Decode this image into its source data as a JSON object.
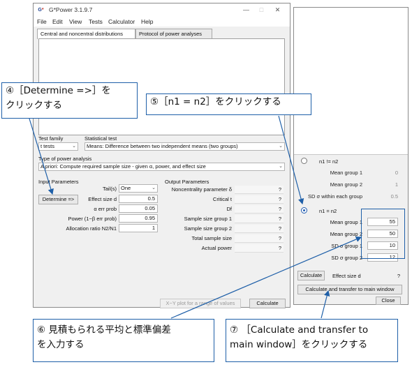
{
  "window": {
    "title": "G*Power 3.1.9.7",
    "minimize_glyph": "—",
    "maximize_glyph": "□",
    "close_glyph": "✕"
  },
  "menu": [
    "File",
    "Edit",
    "View",
    "Tests",
    "Calculator",
    "Help"
  ],
  "tabs": [
    "Central and noncentral distributions",
    "Protocol of power analyses"
  ],
  "test_family": {
    "label": "Test family",
    "value": "t tests"
  },
  "statistical_test": {
    "label": "Statistical test",
    "value": "Means: Difference between two independent means (two groups)"
  },
  "analysis_type": {
    "label": "Type of power analysis",
    "value": "A priori: Compute required sample size - given α, power, and effect size"
  },
  "input": {
    "header": "Input Parameters",
    "tails_label": "Tail(s)",
    "tails_value": "One",
    "determine_label": "Determine =>",
    "effect_label": "Effect size d",
    "effect_value": "0.5",
    "alpha_label": "α err prob",
    "alpha_value": "0.05",
    "power_label": "Power (1−β err prob)",
    "power_value": "0.95",
    "ratio_label": "Allocation ratio N2/N1",
    "ratio_value": "1"
  },
  "output": {
    "header": "Output Parameters",
    "rows": [
      {
        "label": "Noncentrality parameter δ",
        "value": "?"
      },
      {
        "label": "Critical t",
        "value": "?"
      },
      {
        "label": "Df",
        "value": "?"
      },
      {
        "label": "Sample size group 1",
        "value": "?"
      },
      {
        "label": "Sample size group 2",
        "value": "?"
      },
      {
        "label": "Total sample size",
        "value": "?"
      },
      {
        "label": "Actual power",
        "value": "?"
      }
    ]
  },
  "buttons": {
    "xy_plot": "X−Y plot for a range of values",
    "calculate": "Calculate"
  },
  "side_panel": {
    "option1_label": "n1 != n2",
    "option1_selected": false,
    "opt1_mean1_label": "Mean group 1",
    "opt1_mean1_value": "0",
    "opt1_mean2_label": "Mean group 2",
    "opt1_mean2_value": "1",
    "opt1_sd_label": "SD σ within each group",
    "opt1_sd_value": "0.5",
    "option2_label": "n1 = n2",
    "option2_selected": true,
    "mean1_label": "Mean group 1",
    "mean1_value": "55",
    "mean2_label": "Mean group 2",
    "mean2_value": "50",
    "sd1_label": "SD σ group 1",
    "sd1_value": "10",
    "sd2_label": "SD σ group 2",
    "sd2_value": "12",
    "calculate_label": "Calculate",
    "effect_label": "Effect size d",
    "effect_value": "?",
    "transfer_label": "Calculate and transfer to main window",
    "close_label": "Close"
  },
  "annotations": {
    "step4": "④［Determine =>］を\nクリックする",
    "step5": "⑤［n1 = n2］をクリックする",
    "step6": "⑥ 見積もられる平均と標準偏差\nを入力する",
    "step7": "⑦ ［Calculate and transfer to\nmain window］をクリックする"
  },
  "colors": {
    "annotation_blue": "#1e5fa8",
    "radio_blue": "#1f5bb0"
  }
}
